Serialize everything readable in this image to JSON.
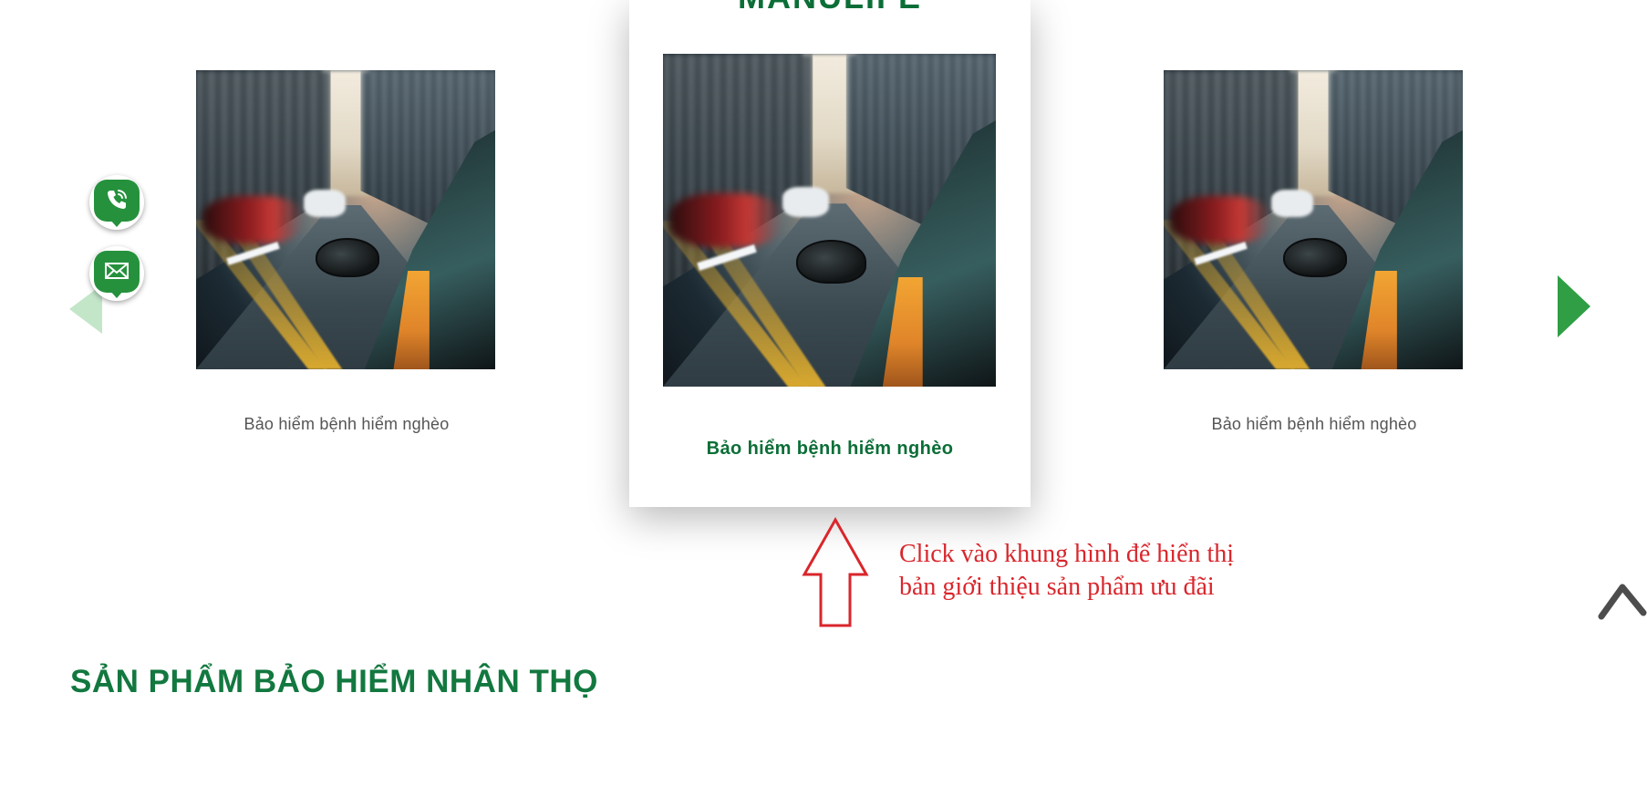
{
  "slider": {
    "center_card": {
      "brand": "MANULIFE",
      "caption": "Bảo hiểm bệnh hiểm nghèo"
    },
    "left_card": {
      "caption": "Bảo hiểm bệnh hiểm nghèo"
    },
    "right_card": {
      "caption": "Bảo hiểm bệnh hiểm nghèo"
    },
    "prev_icon": "triangle-left-icon",
    "next_icon": "triangle-right-icon"
  },
  "floating_contacts": [
    {
      "icon": "phone-icon"
    },
    {
      "icon": "mail-icon"
    }
  ],
  "hint": {
    "line1": "Click vào khung hình để hiển thị",
    "line2": "bản giới thiệu sản phẩm ưu đãi",
    "color": "#d9262c",
    "icon": "up-arrow-outline-icon"
  },
  "back_to_top_icon": "chevron-up-icon",
  "section": {
    "title": "SẢN PHẨM BẢO HIỂM NHÂN THỌ"
  },
  "colors": {
    "brand_green": "#0b6e37",
    "arrow_green": "#2f9e45",
    "arrow_green_light": "#c3e6c9",
    "caption_gray": "#555555"
  }
}
